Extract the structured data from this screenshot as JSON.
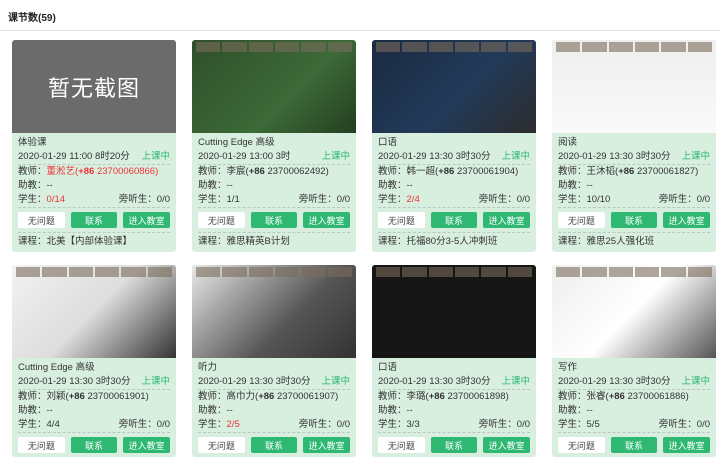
{
  "header": {
    "title": "课节数(59)"
  },
  "labels": {
    "teacher": "教师：",
    "assistant": "助教：",
    "student": "学生：",
    "auditor": "旁听生：",
    "course": "课程：",
    "no_issue": "无问题",
    "contact": "联系",
    "enter": "进入教室",
    "no_screenshot": "暂无截图"
  },
  "cards": [
    {
      "name": "体验课",
      "datetime": "2020-01-29  11:00  8时20分",
      "status": "上课中",
      "teacher": "董淞艺",
      "code": "+86",
      "phone": "23700060866)",
      "assistant": "--",
      "students": "0/14",
      "auditors": "0/0",
      "course": "北美【内部体验课】"
    },
    {
      "name": "Cutting Edge 高级",
      "datetime": "2020-01-29  13:00  3时",
      "status": "上课中",
      "teacher": "李宸",
      "code": "+86",
      "phone": "23700062492)",
      "assistant": "--",
      "students": "1/1",
      "auditors": "0/0",
      "course": "雅思精英B计划"
    },
    {
      "name": "口语",
      "datetime": "2020-01-29  13:30  3时30分",
      "status": "上课中",
      "teacher": "韩一超",
      "code": "+86",
      "phone": "23700061904)",
      "assistant": "--",
      "students": "2/4",
      "auditors": "0/0",
      "course": "托福80分3-5人冲刺班"
    },
    {
      "name": "阅读",
      "datetime": "2020-01-29  13:30  3时30分",
      "status": "上课中",
      "teacher": "王沐韬",
      "code": "+86",
      "phone": "23700061827)",
      "assistant": "--",
      "students": "10/10",
      "auditors": "0/0",
      "course": "雅思25人强化班"
    },
    {
      "name": "Cutting Edge 高级",
      "datetime": "2020-01-29  13:30  3时30分",
      "status": "上课中",
      "teacher": "刘颖",
      "code": "+86",
      "phone": "23700061901)",
      "assistant": "--",
      "students": "4/4",
      "auditors": "0/0"
    },
    {
      "name": "听力",
      "datetime": "2020-01-29  13:30  3时30分",
      "status": "上课中",
      "teacher": "高巾力",
      "code": "+86",
      "phone": "23700061907)",
      "assistant": "--",
      "students": "2/5",
      "auditors": "0/0"
    },
    {
      "name": "口语",
      "datetime": "2020-01-29  13:30  3时30分",
      "status": "上课中",
      "teacher": "李璐",
      "code": "+86",
      "phone": "23700061898)",
      "assistant": "--",
      "students": "3/3",
      "auditors": "0/0"
    },
    {
      "name": "写作",
      "datetime": "2020-01-29  13:30  3时30分",
      "status": "上课中",
      "teacher": "张睿",
      "code": "+86",
      "phone": "23700061886)",
      "assistant": "--",
      "students": "5/5",
      "auditors": "0/0"
    }
  ]
}
